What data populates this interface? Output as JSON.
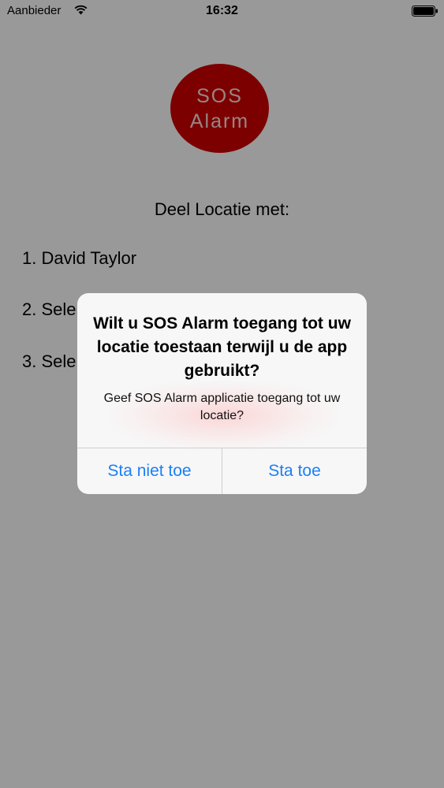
{
  "status_bar": {
    "carrier": "Aanbieder",
    "time": "16:32"
  },
  "app": {
    "sos_button": {
      "line1": "SOS",
      "line2": "Alarm",
      "color": "#d10000"
    },
    "share_heading": "Deel Locatie met:",
    "contacts": [
      "1. David Taylor",
      "2. Sele",
      "3. Sele"
    ]
  },
  "alert": {
    "title": "Wilt u SOS Alarm toegang tot uw locatie toestaan terwijl u de app gebruikt?",
    "message": "Geef SOS Alarm applicatie toegang tot uw locatie?",
    "deny_label": "Sta niet toe",
    "allow_label": "Sta toe",
    "button_color": "#1a7ff5"
  },
  "icons": [
    "wifi-icon",
    "battery-icon"
  ]
}
